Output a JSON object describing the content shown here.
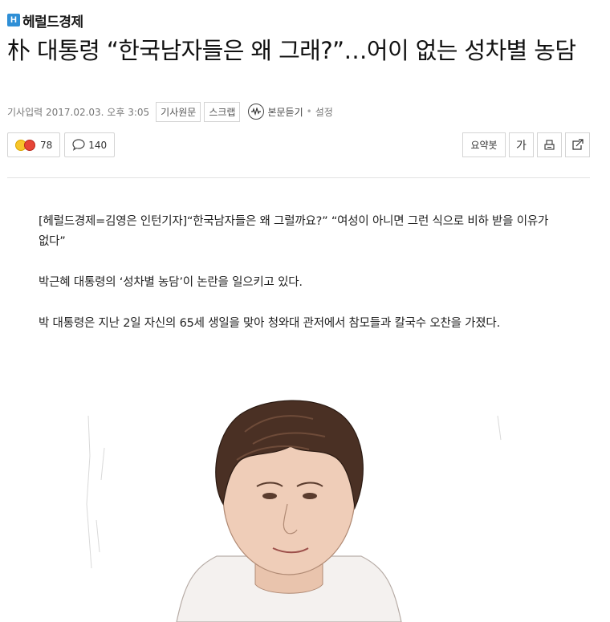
{
  "press": {
    "logo_letter": "H",
    "name": "헤럴드경제"
  },
  "article": {
    "title": "朴 대통령 “한국남자들은 왜 그래?”…어이 없는 성차별 농담",
    "published": "기사입력 2017.02.03. 오후 3:05",
    "original_link": "기사원문",
    "scrap": "스크랩",
    "listen": "본문듣기",
    "settings": "설정",
    "paragraphs": [
      "[헤럴드경제=김영은 인턴기자]“한국남자들은 왜 그럴까요?” “여성이 아니면 그런 식으로 비하 받을 이유가 없다”",
      "박근혜 대통령의 ‘성차별 농담’이 논란을 일으키고 있다.",
      "박 대통령은 지난 2일 자신의 65세 생일을 맞아 청와대 관저에서 참모들과 칼국수 오찬을 가졌다."
    ]
  },
  "toolbar": {
    "reaction_count": "78",
    "comment_count": "140",
    "summary_label": "요약봇",
    "font_label": "가"
  },
  "icons": {
    "reaction": "emoji-reaction-icon",
    "comment": "speech-bubble-icon",
    "print": "print-icon",
    "share": "share-icon",
    "listen": "audio-wave-icon"
  },
  "colors": {
    "brand": "#2f8fd6",
    "reaction_yellow": "#f7c52a",
    "reaction_red": "#e64537"
  }
}
